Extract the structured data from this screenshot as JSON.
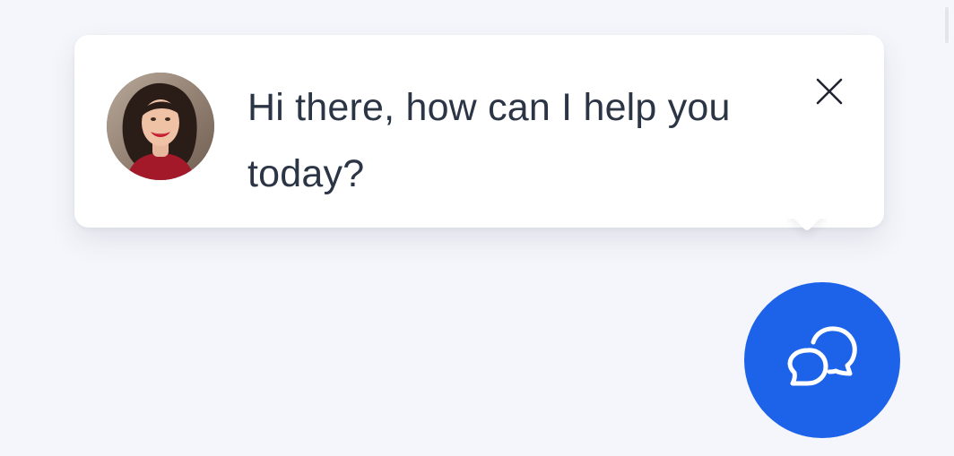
{
  "popup": {
    "message": "Hi there, how can I help you today?",
    "avatar_icon": "agent-avatar-photo",
    "close_icon": "close-icon"
  },
  "launcher": {
    "icon": "chat-bubbles-icon",
    "color": "#1c63ea"
  },
  "colors": {
    "background": "#f5f6fb",
    "popup_background": "#ffffff",
    "message_text": "#2c3545"
  }
}
